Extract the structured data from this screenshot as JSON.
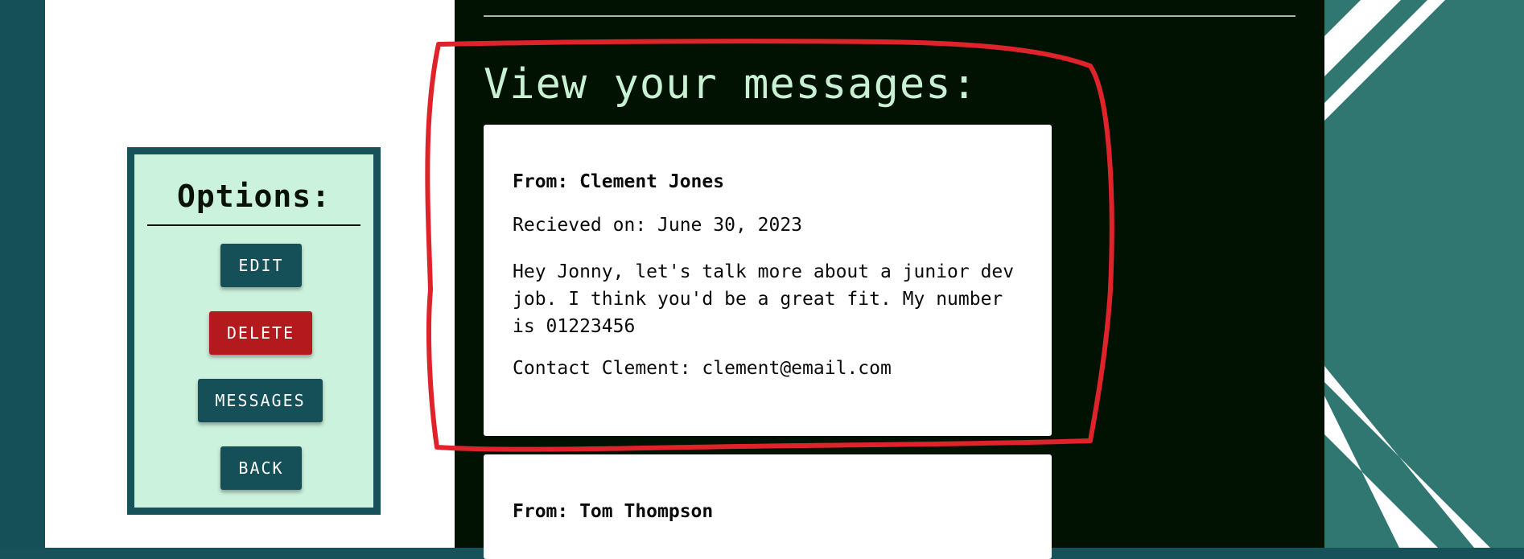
{
  "options": {
    "title": "Options:",
    "buttons": {
      "edit": "EDIT",
      "delete": "DELETE",
      "messages": "MESSAGES",
      "back": "BACK"
    }
  },
  "main": {
    "title": "View your messages:",
    "messages": [
      {
        "from": "From: Clement Jones",
        "received": "Recieved on: June 30, 2023",
        "body": "Hey Jonny, let's talk more about a junior dev job. I think you'd be a great fit. My number is 01223456",
        "contact": "Contact Clement: clement@email.com"
      },
      {
        "from": "From: Tom Thompson"
      }
    ]
  },
  "colors": {
    "teal": "#17515a",
    "mint": "#cbf2dc",
    "dark": "#021202",
    "danger": "#b4191d",
    "annotation": "#e0232a"
  }
}
